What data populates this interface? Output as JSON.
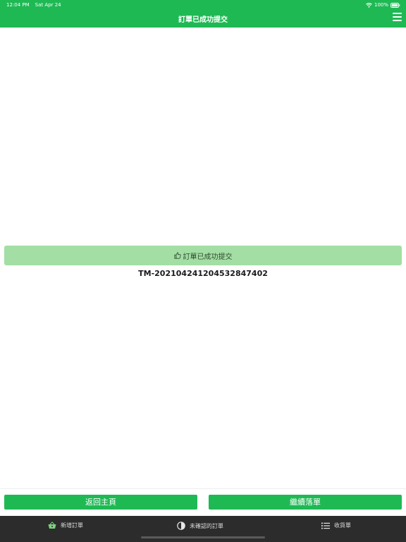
{
  "status_bar": {
    "time": "12:04 PM",
    "date": "Sat Apr 24",
    "battery": "100%"
  },
  "nav": {
    "title": "訂單已成功提交",
    "menu_icon": "hamburger-menu-icon"
  },
  "banner": {
    "icon": "thumbs-up-icon",
    "text": "訂單已成功提交"
  },
  "order": {
    "number": "TM-20210424120453284740​2"
  },
  "actions": {
    "back_home": "返回主頁",
    "continue_order": "繼續落單"
  },
  "tabbar": {
    "items": [
      {
        "label": "新增訂單",
        "icon": "basket-icon"
      },
      {
        "label": "未確認的訂單",
        "icon": "half-circle-icon"
      },
      {
        "label": "收貨單",
        "icon": "list-icon"
      }
    ]
  },
  "colors": {
    "primary": "#1fb954",
    "banner_bg": "#a3dea4",
    "tabbar_bg": "#2c2c2c",
    "active_tab_icon": "#7fcf7f"
  }
}
